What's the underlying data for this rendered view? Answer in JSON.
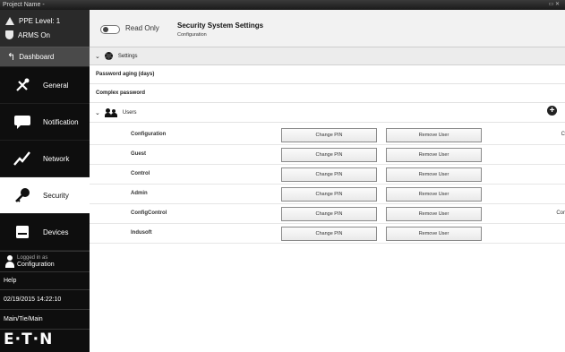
{
  "window": {
    "title": "Project Name -",
    "controls": "▭ ✕"
  },
  "sidebar": {
    "status": {
      "ppe_level": "PPE Level: 1",
      "arms": "ARMS On"
    },
    "dashboard_label": "Dashboard",
    "nav_items": [
      {
        "label": "General",
        "icon": "tools-icon"
      },
      {
        "label": "Notification",
        "icon": "chat-bubble-icon"
      },
      {
        "label": "Network",
        "icon": "network-icon"
      },
      {
        "label": "Security",
        "icon": "key-icon",
        "active": true
      },
      {
        "label": "Devices",
        "icon": "devices-icon"
      }
    ],
    "logged_in": {
      "line1": "Logged in as",
      "line2": "Configuration"
    },
    "help": "Help",
    "datetime": "02/19/2015 14:22:10",
    "location": "Main/Tie/Main",
    "logo": "E·T·N"
  },
  "header": {
    "read_only_label": "Read Only",
    "title": "Security System Settings",
    "subtitle": "Configuration"
  },
  "settings": {
    "section_label": "Settings",
    "rows": [
      "Password aging (days)",
      "Complex password"
    ]
  },
  "users": {
    "section_label": "Users",
    "change_pin_label": "Change PIN",
    "remove_user_label": "Remove User",
    "rows": [
      {
        "name": "Configuration",
        "overflow": "C"
      },
      {
        "name": "Guest",
        "overflow": ""
      },
      {
        "name": "Control",
        "overflow": ""
      },
      {
        "name": "Admin",
        "overflow": ""
      },
      {
        "name": "ConfigControl",
        "overflow": "Cor"
      },
      {
        "name": "Indusoft",
        "overflow": ""
      }
    ]
  },
  "colors": {
    "sidebar_bg": "#0e0e0e",
    "active_nav_bg": "#ffffff",
    "header_bg": "#f2f2f2",
    "section_bar_bg": "#ececec"
  }
}
